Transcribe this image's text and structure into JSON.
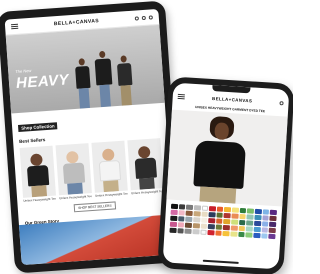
{
  "tablet": {
    "logo": "BELLA+CANVAS",
    "hero_kicker": "The New",
    "hero_title": "HEAVY",
    "dark_label": "Shop Collection",
    "best_sellers": "Best Sellers",
    "products": [
      {
        "caption": "Unisex Heavyweight Tee",
        "shirt": "#1d1d1d"
      },
      {
        "caption": "Unisex Heavyweight Tee",
        "shirt": "#bdbdbd"
      },
      {
        "caption": "Unisex Heavyweight Tee",
        "shirt": "#f4f4f4"
      },
      {
        "caption": "Unisex Heavyweight Tee",
        "shirt": "#2b2b2b"
      }
    ],
    "cta": "SHOP BEST SELLERS",
    "story": "Our Green Story"
  },
  "phone": {
    "logo": "BELLA+CANVAS",
    "product_title": "UNISEX HEAVYWEIGHT GARMENT DYED TEE",
    "swatches": [
      "#111111",
      "#3b3b3b",
      "#7a7a7a",
      "#bdbdbd",
      "#ffffff",
      "#c81e2a",
      "#e85a2a",
      "#f3b530",
      "#f5e27a",
      "#2f7d3a",
      "#7bbf6a",
      "#1f4fa8",
      "#7db4e6",
      "#5a2a82",
      "#d46aa5",
      "#f2b8c6",
      "#8a5a3b",
      "#c8a77a",
      "#e8dcc4",
      "#2a3b5c",
      "#5b6e2e",
      "#b0352f",
      "#ea8c55",
      "#f7d46a",
      "#93c7b4",
      "#3a8fb7",
      "#a3a3d6",
      "#6d2f3a",
      "#1b1b1b",
      "#4a5a6a",
      "#9aa7b0",
      "#d9d4cc",
      "#f4efe4",
      "#a81f2d",
      "#d9622b",
      "#e0a62a",
      "#cfe07a",
      "#2b6b4a",
      "#6aa58a",
      "#2c4a9a",
      "#8ab0e8",
      "#4a2a6a",
      "#c9578f",
      "#f0a8b8",
      "#6b4a32",
      "#b89468",
      "#ebe0cc",
      "#33415e",
      "#6a7a38",
      "#9a2f2a",
      "#f09a6a",
      "#f2c85a",
      "#a8d8c4",
      "#4a9ad0",
      "#b8b8e4",
      "#7a3a48",
      "#262626",
      "#555555",
      "#8f8f8f",
      "#cccccc",
      "#fafafa",
      "#d0232f",
      "#ef7030",
      "#f6c23a",
      "#e8e48a",
      "#3a8a48",
      "#8ccc78",
      "#2a5cc0",
      "#9cc8f0",
      "#6a3a92"
    ]
  }
}
